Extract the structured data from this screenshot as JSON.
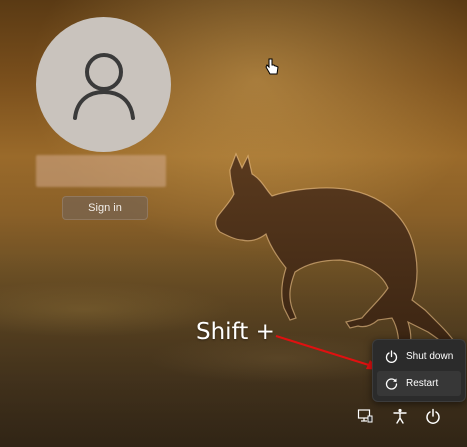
{
  "login": {
    "sign_in_label": "Sign in"
  },
  "annotation": {
    "text": "Shift +"
  },
  "power_menu": {
    "items": [
      {
        "label": "Shut down",
        "icon": "power-icon"
      },
      {
        "label": "Restart",
        "icon": "restart-icon"
      }
    ]
  },
  "taskbar_icons": [
    "network-icon",
    "accessibility-icon",
    "power-icon"
  ],
  "colors": {
    "menu_bg": "#2b2b2b",
    "arrow": "#e01010",
    "avatar_bg": "#c9c3bd"
  }
}
